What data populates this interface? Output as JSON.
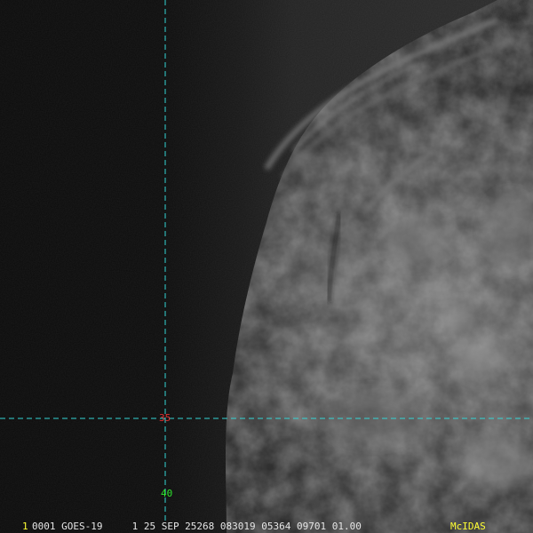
{
  "overlay": {
    "latitude_label": "35",
    "longitude_label": "40",
    "frame_number": "1",
    "info_bar": "0001 GOES-19     1 25 SEP 25268 083019 05364 09701 01.00",
    "brand": "McIDAS"
  },
  "colors": {
    "background": "#0b0b0b",
    "gridline": "#33d6d6",
    "latitude_label": "#e03030",
    "longitude_label": "#2ee62e",
    "frame_number": "#ffff33",
    "info_text": "#e6e6e6",
    "brand_text": "#ffff33"
  },
  "icons": {
    "gridlines": "dashed-crosshair"
  }
}
